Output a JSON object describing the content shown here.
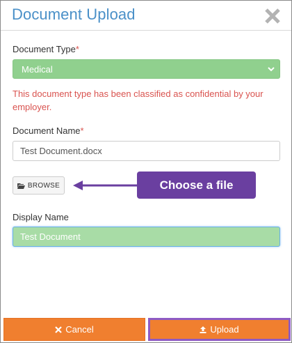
{
  "dialog": {
    "title": "Document Upload",
    "close_icon": "close-icon"
  },
  "document_type": {
    "label": "Document Type",
    "required_mark": "*",
    "selected": "Medical",
    "warning": "This document type has been classified as confidential by your employer."
  },
  "document_name": {
    "label": "Document Name",
    "required_mark": "*",
    "value": "Test Document.docx"
  },
  "browse": {
    "label": "BROWSE",
    "icon": "folder-open-icon"
  },
  "callout": {
    "text": "Choose a file"
  },
  "display_name": {
    "label": "Display Name",
    "value": "Test Document"
  },
  "footer": {
    "cancel_label": "Cancel",
    "cancel_icon": "x-icon",
    "upload_label": "Upload",
    "upload_icon": "upload-icon"
  },
  "colors": {
    "title": "#4a90c8",
    "select_bg": "#90d08e",
    "warning": "#d9534f",
    "callout_bg": "#6a3fa0",
    "button_bg": "#f07f2f",
    "highlight_border": "#8e5bc4"
  }
}
